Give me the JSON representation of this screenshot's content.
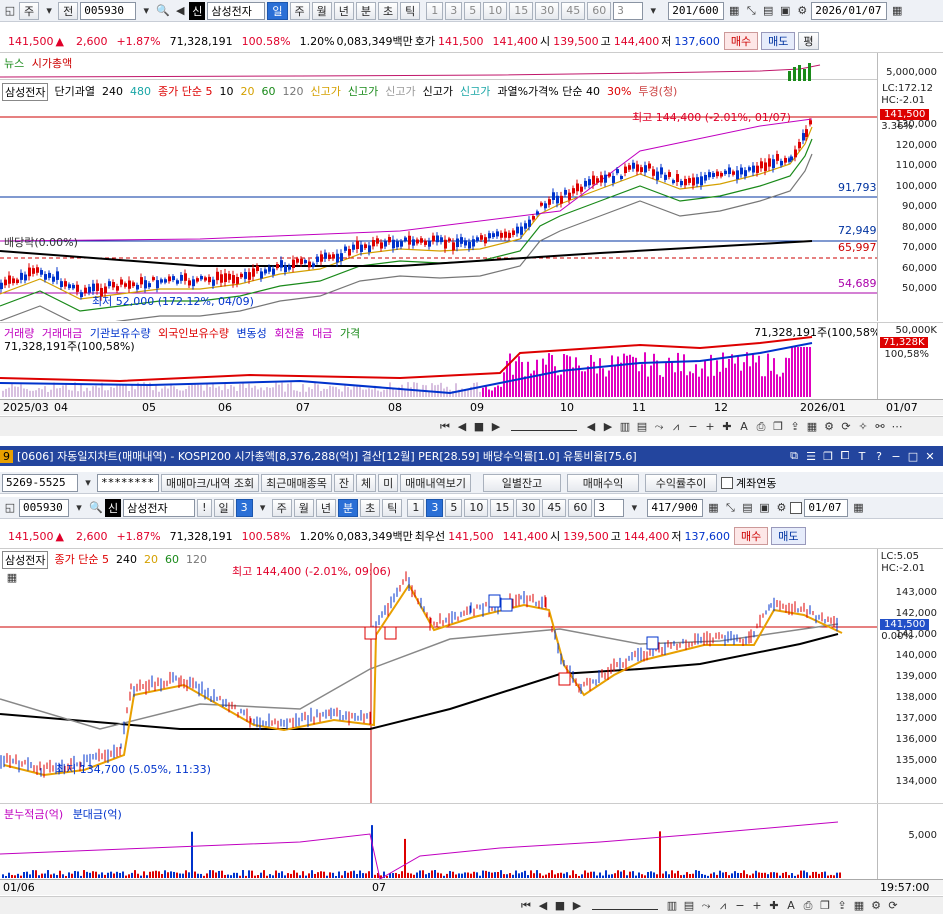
{
  "top": {
    "toolbar": {
      "mode": "주",
      "market": "전",
      "code": "005930",
      "name_badge": "신",
      "name": "삼성전자",
      "periods": [
        "일",
        "주",
        "월",
        "년",
        "분",
        "초",
        "틱"
      ],
      "period_selected": "일",
      "nums": [
        "1",
        "3",
        "5",
        "10",
        "15",
        "30",
        "45",
        "60"
      ],
      "num_input": "3",
      "count": "201/600",
      "date": "2026/01/07"
    },
    "quote": {
      "price": "141,500",
      "arrow": "▲",
      "change": "2,600",
      "pct": "+1.87%",
      "volume": "71,328,191",
      "vol_ratio": "100.58%",
      "turnover": "1.20%",
      "amount": "0,083,349백만",
      "ask_label": "호가",
      "ask": "141,500",
      "bid": "141,400",
      "open_label": "시",
      "open": "139,500",
      "high_label": "고",
      "high": "144,400",
      "low_label": "저",
      "low": "137,600",
      "buy": "매수",
      "sell": "매도",
      "eval": "평"
    },
    "news_legend": [
      "뉴스",
      "시가총액"
    ],
    "news_axis": "5,000,000",
    "legend": {
      "name": "삼성전자",
      "items": [
        {
          "t": "단기과열",
          "c": "#000"
        },
        {
          "t": "240",
          "c": "#000"
        },
        {
          "t": "480",
          "c": "#19a6a6"
        },
        {
          "t": "종가 단순 5",
          "c": "#d00"
        },
        {
          "t": "10",
          "c": "#000"
        },
        {
          "t": "20",
          "c": "#d4a000"
        },
        {
          "t": "60",
          "c": "#1a8a1a"
        },
        {
          "t": "120",
          "c": "#777"
        },
        {
          "t": "신고가",
          "c": "#d4a000"
        },
        {
          "t": "신고가",
          "c": "#1a8a1a"
        },
        {
          "t": "신고가",
          "c": "#999"
        },
        {
          "t": "신고가",
          "c": "#000"
        },
        {
          "t": "신고가",
          "c": "#19a6a6"
        },
        {
          "t": "과열%가격% 단순 40",
          "c": "#000"
        },
        {
          "t": "30%",
          "c": "#d00"
        },
        {
          "t": "투경(청)",
          "c": "#c44"
        }
      ]
    },
    "ann": {
      "high": "최고 144,400 (-2.01%, 01/07)",
      "low": "최저 52,000 (172.12%, 04/09)",
      "div": "배당락(0.00%)",
      "lc": "LC:172.12",
      "hc": "HC:-2.01",
      "cur": "141,500",
      "cur_pct": "3.36%",
      "lvl1": "91,793",
      "lvl2": "72,949",
      "lvl3": "65,997",
      "lvl4": "54,689"
    },
    "price_ticks": [
      "130,000",
      "120,000",
      "110,000",
      "100,000",
      "90,000",
      "80,000",
      "70,000",
      "60,000",
      "50,000"
    ],
    "vol_legend": [
      "거래량",
      "거래대금",
      "기관보유수량",
      "외국인보유수량",
      "변동성",
      "회전율",
      "대금",
      "가격"
    ],
    "vol_info": "71,328,191주(100,58%)",
    "vol_info2": "71,328,191주(100,58%)",
    "vol_axis": [
      "50,000K"
    ],
    "vol_cur": "71,328K",
    "vol_cur_pct": "100,58%",
    "x_labels": [
      "2025/03",
      "04",
      "05",
      "06",
      "07",
      "08",
      "09",
      "10",
      "11",
      "12",
      "2026/01"
    ],
    "x_axis_right": "01/07"
  },
  "bottom": {
    "title": "[0606] 자동일지차트(매매내역) - KOSPI200 시가총액[8,376,288(억)] 결산[12월] PER[28.59] 배당수익률[1.0] 유통비율[75.6]",
    "title_num": "9",
    "row1": {
      "account": "5269-5525",
      "password": "********",
      "b1": "매매마크/내역 조회",
      "b2": "최근매매종목",
      "b3": "잔",
      "b4": "체",
      "b5": "미",
      "b6": "매매내역보기",
      "b7": "일별잔고",
      "b8": "매매수익",
      "b9": "수익률추이",
      "chk": "계좌연동"
    },
    "row2": {
      "code": "005930",
      "badge": "신",
      "name": "삼성전자",
      "bang": "!",
      "period": "일",
      "num": "3",
      "periods": [
        "주",
        "월",
        "년",
        "분",
        "초",
        "틱"
      ],
      "period_selected": "분",
      "nums": [
        "1",
        "3",
        "5",
        "10",
        "15",
        "30",
        "45",
        "60"
      ],
      "num_selected": "3",
      "num_input": "3",
      "count": "417/900",
      "date": "01/07"
    },
    "quote": {
      "price": "141,500",
      "arrow": "▲",
      "change": "2,600",
      "pct": "+1.87%",
      "volume": "71,328,191",
      "vol_ratio": "100.58%",
      "turnover": "1.20%",
      "amount": "0,083,349백만",
      "ask_label": "최우선",
      "ask": "141,500",
      "bid": "141,400",
      "open_label": "시",
      "open": "139,500",
      "high_label": "고",
      "high": "144,400",
      "low_label": "저",
      "low": "137,600",
      "buy": "매수",
      "sell": "매도"
    },
    "legend": {
      "name": "삼성전자",
      "items": [
        {
          "t": "종가 단순 5",
          "c": "#d00"
        },
        {
          "t": "240",
          "c": "#000"
        },
        {
          "t": "20",
          "c": "#d4a000"
        },
        {
          "t": "60",
          "c": "#1a8a1a"
        },
        {
          "t": "120",
          "c": "#777"
        }
      ]
    },
    "ann": {
      "high": "최고 144,400 (-2.01%, 09:06)",
      "low": "최저 134,700 (5.05%, 11:33)",
      "lc": "LC:5.05",
      "hc": "HC:-2.01",
      "cur": "141,500",
      "cur_pct": "0.00%"
    },
    "price_ticks": [
      "143,000",
      "142,000",
      "141,000",
      "140,000",
      "139,000",
      "138,000",
      "137,000",
      "136,000",
      "135,000",
      "134,000"
    ],
    "vol_legend": [
      "분누적금(억)",
      "분대금(억)"
    ],
    "vol_axis": [
      "5,000"
    ],
    "x_labels": [
      "01/06",
      "07"
    ],
    "time": "19:57:00"
  }
}
